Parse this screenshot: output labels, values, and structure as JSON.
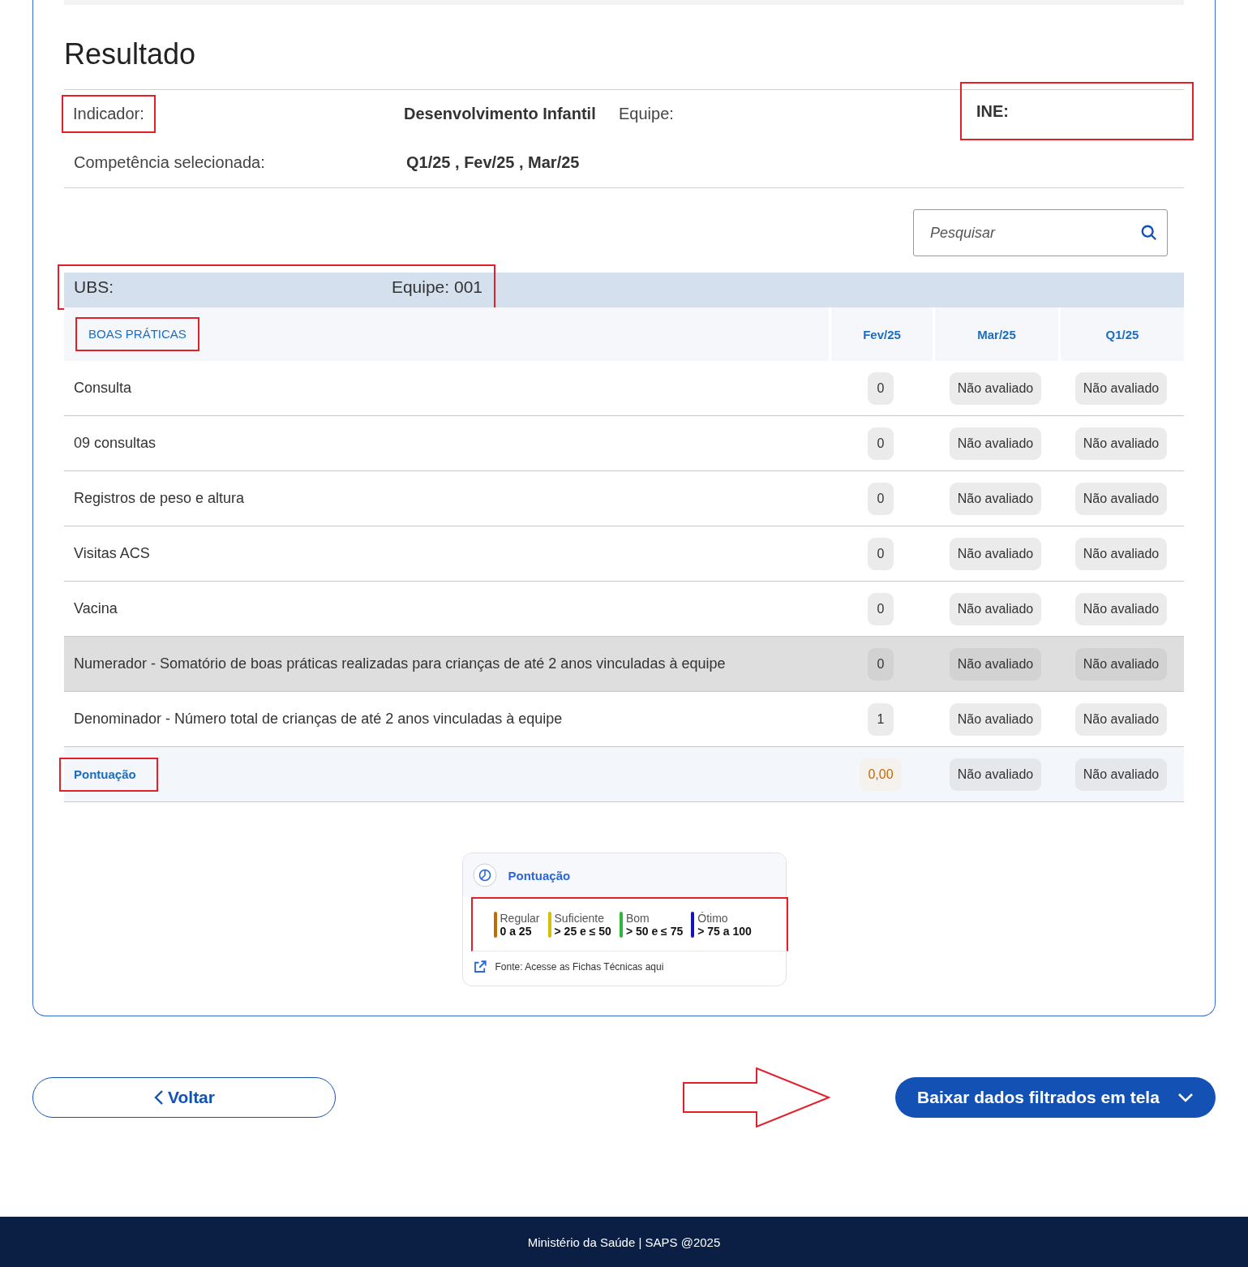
{
  "title": "Resultado",
  "info": {
    "indicator_label": {
      "text": "Indicador:",
      "highlighted": true
    },
    "indicator_value": "Desenvolvimento Infantil",
    "team_label": "Equipe:",
    "ine_label": {
      "text": "INE:",
      "highlighted": true
    },
    "period_label": "Competência selecionada:",
    "period_value": "Q1/25 , Fev/25 , Mar/25"
  },
  "search": {
    "placeholder": "Pesquisar"
  },
  "team_band": {
    "ubs": "UBS:",
    "team": "Equipe: 001",
    "highlighted": true
  },
  "table": {
    "section": {
      "text": "BOAS PRÁTICAS",
      "highlighted": true
    },
    "columns": [
      "Fev/25",
      "Mar/25",
      "Q1/25"
    ],
    "rows": [
      {
        "kind": "normal",
        "label": "Consulta",
        "cells": [
          "0",
          "Não avaliado",
          "Não avaliado"
        ]
      },
      {
        "kind": "normal",
        "label": "09 consultas",
        "cells": [
          "0",
          "Não avaliado",
          "Não avaliado"
        ]
      },
      {
        "kind": "normal",
        "label": "Registros de peso e altura",
        "cells": [
          "0",
          "Não avaliado",
          "Não avaliado"
        ]
      },
      {
        "kind": "normal",
        "label": "Visitas ACS",
        "cells": [
          "0",
          "Não avaliado",
          "Não avaliado"
        ]
      },
      {
        "kind": "normal",
        "label": "Vacina",
        "cells": [
          "0",
          "Não avaliado",
          "Não avaliado"
        ]
      },
      {
        "kind": "total",
        "label": "Numerador - Somatório de boas práticas realizadas para crianças de até 2 anos vinculadas à equipe",
        "cells": [
          "0",
          "Não avaliado",
          "Não avaliado"
        ]
      },
      {
        "kind": "normal",
        "label": "Denominador - Número total de crianças de até 2 anos vinculadas à equipe",
        "cells": [
          "1",
          "Não avaliado",
          "Não avaliado"
        ]
      },
      {
        "kind": "score",
        "label": "Pontuação",
        "highlighted": true,
        "cells": [
          "0,00",
          "Não avaliado",
          "Não avaliado"
        ]
      }
    ]
  },
  "legend": {
    "title": "Pontuação",
    "highlighted": true,
    "items": [
      {
        "name": "Regular",
        "range": "0 a 25",
        "color": "#c46a00"
      },
      {
        "name": "Suficiente",
        "range": "> 25 e ≤ 50",
        "color": "#d4c000"
      },
      {
        "name": "Bom",
        "range": "> 50 e ≤ 75",
        "color": "#2db83d"
      },
      {
        "name": "Ótimo",
        "range": "> 75 a 100",
        "color": "#1414b8"
      }
    ],
    "source": "Fonte: Acesse as Fichas Técnicas aqui"
  },
  "actions": {
    "back": "Voltar",
    "download": "Baixar dados filtrados em tela",
    "arrow_annotation": true
  },
  "footer": "Ministério da Saúde | SAPS @2025"
}
